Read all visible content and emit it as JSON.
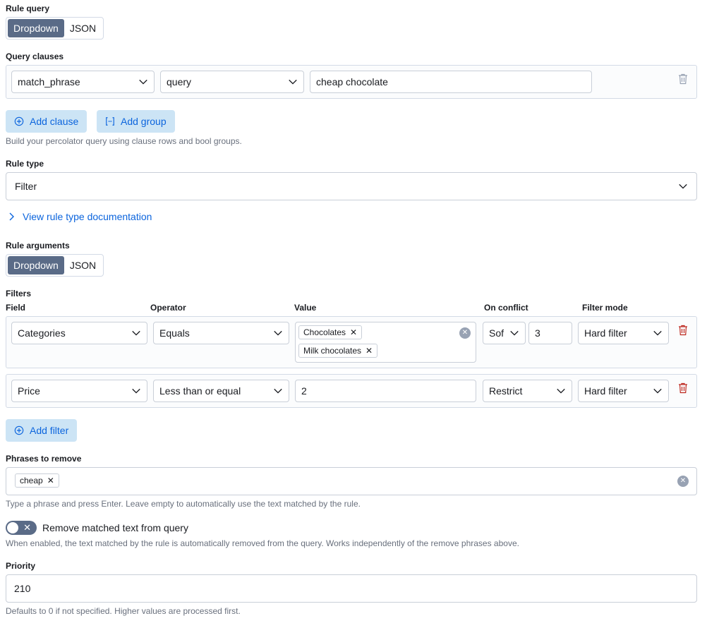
{
  "rule_query": {
    "label": "Rule query",
    "modes": [
      "Dropdown",
      "JSON"
    ],
    "active_mode": "Dropdown"
  },
  "query_clauses": {
    "label": "Query clauses",
    "clause": {
      "type": "match_phrase",
      "field": "query",
      "value": "cheap chocolate"
    },
    "add_clause": "Add clause",
    "add_group": "Add group",
    "help": "Build your percolator query using clause rows and bool groups."
  },
  "rule_type": {
    "label": "Rule type",
    "value": "Filter",
    "doc_link": "View rule type documentation"
  },
  "rule_arguments": {
    "label": "Rule arguments",
    "modes": [
      "Dropdown",
      "JSON"
    ],
    "active_mode": "Dropdown"
  },
  "filters": {
    "label": "Filters",
    "columns": [
      "Field",
      "Operator",
      "Value",
      "On conflict",
      "Filter mode"
    ],
    "rows": [
      {
        "field": "Categories",
        "operator": "Equals",
        "values": [
          "Chocolates",
          "Milk chocolates"
        ],
        "conflict": "Sof",
        "conflict_num": "3",
        "mode": "Hard filter"
      },
      {
        "field": "Price",
        "operator": "Less than or equal",
        "value": "2",
        "conflict": "Restrict",
        "mode": "Hard filter"
      }
    ],
    "add_filter": "Add filter"
  },
  "phrases": {
    "label": "Phrases to remove",
    "chips": [
      "cheap"
    ],
    "help": "Type a phrase and press Enter. Leave empty to automatically use the text matched by the rule."
  },
  "remove_matched": {
    "label": "Remove matched text from query",
    "help": "When enabled, the text matched by the rule is automatically removed from the query. Works independently of the remove phrases above.",
    "enabled": false
  },
  "priority": {
    "label": "Priority",
    "value": "210",
    "help": "Defaults to 0 if not specified. Higher values are processed first."
  },
  "colors": {
    "accent": "#0b64dd",
    "segment_active": "#5a6b87",
    "danger": "#bd271e"
  }
}
